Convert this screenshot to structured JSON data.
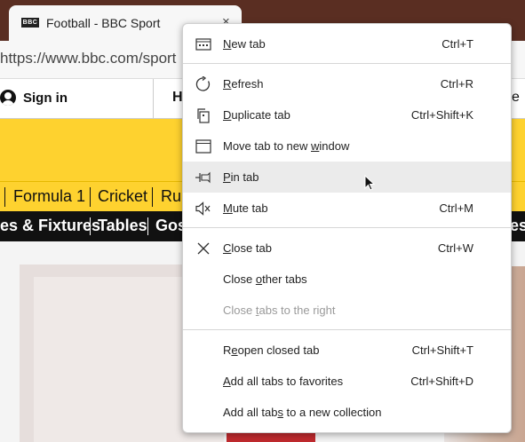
{
  "browser": {
    "tab_title": "Football - BBC Sport",
    "tab_favicon_text": "BBC",
    "tab_close_glyph": "×",
    "url": "https://www.bbc.com/sport"
  },
  "bbc": {
    "signin_label": "Sign in",
    "header_partial_left": "H",
    "header_partial_right": "e",
    "sport_nav": [
      "Formula 1",
      "Cricket",
      "Ru"
    ],
    "sub_nav": [
      "es & Fixtures",
      "Tables",
      "Gos"
    ],
    "sub_nav_right_partial": "es"
  },
  "context_menu": {
    "items": [
      {
        "pre": "",
        "acc": "N",
        "post": "ew tab",
        "shortcut": "Ctrl+T",
        "icon": "new-tab-icon"
      },
      {
        "pre": "",
        "acc": "R",
        "post": "efresh",
        "shortcut": "Ctrl+R",
        "icon": "refresh-icon"
      },
      {
        "pre": "",
        "acc": "D",
        "post": "uplicate tab",
        "shortcut": "Ctrl+Shift+K",
        "icon": "duplicate-tab-icon"
      },
      {
        "pre": "Move tab to new ",
        "acc": "w",
        "post": "indow",
        "shortcut": "",
        "icon": "window-icon"
      },
      {
        "pre": "",
        "acc": "P",
        "post": "in tab",
        "shortcut": "",
        "icon": "pin-icon"
      },
      {
        "pre": "",
        "acc": "M",
        "post": "ute tab",
        "shortcut": "Ctrl+M",
        "icon": "mute-icon"
      },
      {
        "pre": "",
        "acc": "C",
        "post": "lose tab",
        "shortcut": "Ctrl+W",
        "icon": "close-icon"
      },
      {
        "pre": "Close ",
        "acc": "o",
        "post": "ther tabs",
        "shortcut": "",
        "icon": ""
      },
      {
        "pre": "Close ",
        "acc": "t",
        "post": "abs to the right",
        "shortcut": "",
        "icon": "",
        "disabled": true
      },
      {
        "pre": "R",
        "acc": "e",
        "post": "open closed tab",
        "shortcut": "Ctrl+Shift+T",
        "icon": ""
      },
      {
        "pre": "",
        "acc": "A",
        "post": "dd all tabs to favorites",
        "shortcut": "Ctrl+Shift+D",
        "icon": ""
      },
      {
        "pre": "Add all tab",
        "acc": "s",
        "post": " to a new collection",
        "shortcut": "",
        "icon": ""
      }
    ]
  },
  "colors": {
    "bbc_yellow": "#fed22f",
    "menu_hover": "#ebebeb",
    "disabled_text": "#9a9a9a"
  }
}
